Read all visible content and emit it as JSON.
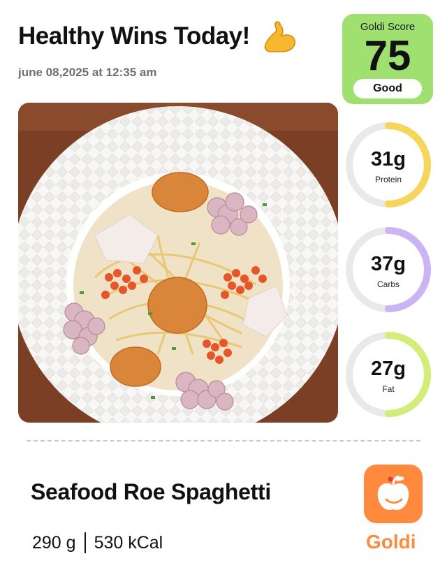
{
  "header": {
    "title": "Healthy Wins Today!",
    "flex_icon": "flexed-biceps-icon",
    "date": "june 08,2025 at 12:35 am"
  },
  "score": {
    "label": "Goldi Score",
    "value": "75",
    "rating": "Good",
    "color": "#9fe070"
  },
  "macros": [
    {
      "value": "31g",
      "label": "Protein",
      "color": "#f7d55a",
      "fraction": 0.5
    },
    {
      "value": "37g",
      "label": "Carbs",
      "color": "#cbb4f4",
      "fraction": 0.5
    },
    {
      "value": "27g",
      "label": "Fat",
      "color": "#d4ec78",
      "fraction": 0.5
    }
  ],
  "meal": {
    "name": "Seafood Roe Spaghetti",
    "weight": "290 g",
    "calories": "530 kCal"
  },
  "brand": {
    "name": "Goldi",
    "icon": "apple-logo-icon",
    "color": "#ff8a3d"
  }
}
